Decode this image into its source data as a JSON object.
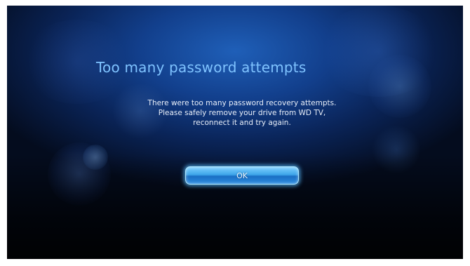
{
  "dialog": {
    "title": "Too many password attempts",
    "message_lines": [
      "There were too many password recovery attempts.",
      "Please safely remove your drive from WD TV,",
      "reconnect it and try again."
    ],
    "ok_label": "OK"
  },
  "colors": {
    "background": "#0a2458",
    "title": "#7fc3ff",
    "text": "#e8eef8",
    "button": "#3fa6ea"
  }
}
